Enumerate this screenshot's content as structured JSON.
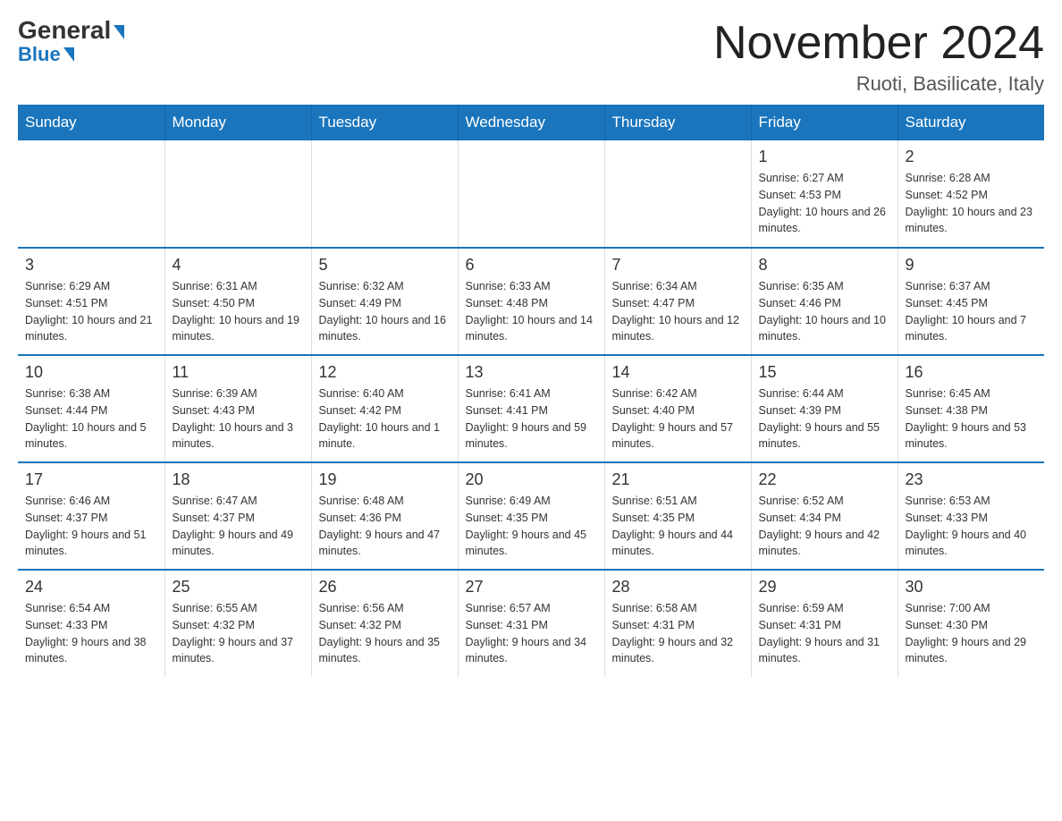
{
  "logo": {
    "general": "General",
    "blue_letter": "B",
    "blue_rest": "lue"
  },
  "title": "November 2024",
  "location": "Ruoti, Basilicate, Italy",
  "weekdays": [
    "Sunday",
    "Monday",
    "Tuesday",
    "Wednesday",
    "Thursday",
    "Friday",
    "Saturday"
  ],
  "weeks": [
    [
      {
        "day": "",
        "info": ""
      },
      {
        "day": "",
        "info": ""
      },
      {
        "day": "",
        "info": ""
      },
      {
        "day": "",
        "info": ""
      },
      {
        "day": "",
        "info": ""
      },
      {
        "day": "1",
        "info": "Sunrise: 6:27 AM\nSunset: 4:53 PM\nDaylight: 10 hours and 26 minutes."
      },
      {
        "day": "2",
        "info": "Sunrise: 6:28 AM\nSunset: 4:52 PM\nDaylight: 10 hours and 23 minutes."
      }
    ],
    [
      {
        "day": "3",
        "info": "Sunrise: 6:29 AM\nSunset: 4:51 PM\nDaylight: 10 hours and 21 minutes."
      },
      {
        "day": "4",
        "info": "Sunrise: 6:31 AM\nSunset: 4:50 PM\nDaylight: 10 hours and 19 minutes."
      },
      {
        "day": "5",
        "info": "Sunrise: 6:32 AM\nSunset: 4:49 PM\nDaylight: 10 hours and 16 minutes."
      },
      {
        "day": "6",
        "info": "Sunrise: 6:33 AM\nSunset: 4:48 PM\nDaylight: 10 hours and 14 minutes."
      },
      {
        "day": "7",
        "info": "Sunrise: 6:34 AM\nSunset: 4:47 PM\nDaylight: 10 hours and 12 minutes."
      },
      {
        "day": "8",
        "info": "Sunrise: 6:35 AM\nSunset: 4:46 PM\nDaylight: 10 hours and 10 minutes."
      },
      {
        "day": "9",
        "info": "Sunrise: 6:37 AM\nSunset: 4:45 PM\nDaylight: 10 hours and 7 minutes."
      }
    ],
    [
      {
        "day": "10",
        "info": "Sunrise: 6:38 AM\nSunset: 4:44 PM\nDaylight: 10 hours and 5 minutes."
      },
      {
        "day": "11",
        "info": "Sunrise: 6:39 AM\nSunset: 4:43 PM\nDaylight: 10 hours and 3 minutes."
      },
      {
        "day": "12",
        "info": "Sunrise: 6:40 AM\nSunset: 4:42 PM\nDaylight: 10 hours and 1 minute."
      },
      {
        "day": "13",
        "info": "Sunrise: 6:41 AM\nSunset: 4:41 PM\nDaylight: 9 hours and 59 minutes."
      },
      {
        "day": "14",
        "info": "Sunrise: 6:42 AM\nSunset: 4:40 PM\nDaylight: 9 hours and 57 minutes."
      },
      {
        "day": "15",
        "info": "Sunrise: 6:44 AM\nSunset: 4:39 PM\nDaylight: 9 hours and 55 minutes."
      },
      {
        "day": "16",
        "info": "Sunrise: 6:45 AM\nSunset: 4:38 PM\nDaylight: 9 hours and 53 minutes."
      }
    ],
    [
      {
        "day": "17",
        "info": "Sunrise: 6:46 AM\nSunset: 4:37 PM\nDaylight: 9 hours and 51 minutes."
      },
      {
        "day": "18",
        "info": "Sunrise: 6:47 AM\nSunset: 4:37 PM\nDaylight: 9 hours and 49 minutes."
      },
      {
        "day": "19",
        "info": "Sunrise: 6:48 AM\nSunset: 4:36 PM\nDaylight: 9 hours and 47 minutes."
      },
      {
        "day": "20",
        "info": "Sunrise: 6:49 AM\nSunset: 4:35 PM\nDaylight: 9 hours and 45 minutes."
      },
      {
        "day": "21",
        "info": "Sunrise: 6:51 AM\nSunset: 4:35 PM\nDaylight: 9 hours and 44 minutes."
      },
      {
        "day": "22",
        "info": "Sunrise: 6:52 AM\nSunset: 4:34 PM\nDaylight: 9 hours and 42 minutes."
      },
      {
        "day": "23",
        "info": "Sunrise: 6:53 AM\nSunset: 4:33 PM\nDaylight: 9 hours and 40 minutes."
      }
    ],
    [
      {
        "day": "24",
        "info": "Sunrise: 6:54 AM\nSunset: 4:33 PM\nDaylight: 9 hours and 38 minutes."
      },
      {
        "day": "25",
        "info": "Sunrise: 6:55 AM\nSunset: 4:32 PM\nDaylight: 9 hours and 37 minutes."
      },
      {
        "day": "26",
        "info": "Sunrise: 6:56 AM\nSunset: 4:32 PM\nDaylight: 9 hours and 35 minutes."
      },
      {
        "day": "27",
        "info": "Sunrise: 6:57 AM\nSunset: 4:31 PM\nDaylight: 9 hours and 34 minutes."
      },
      {
        "day": "28",
        "info": "Sunrise: 6:58 AM\nSunset: 4:31 PM\nDaylight: 9 hours and 32 minutes."
      },
      {
        "day": "29",
        "info": "Sunrise: 6:59 AM\nSunset: 4:31 PM\nDaylight: 9 hours and 31 minutes."
      },
      {
        "day": "30",
        "info": "Sunrise: 7:00 AM\nSunset: 4:30 PM\nDaylight: 9 hours and 29 minutes."
      }
    ]
  ]
}
